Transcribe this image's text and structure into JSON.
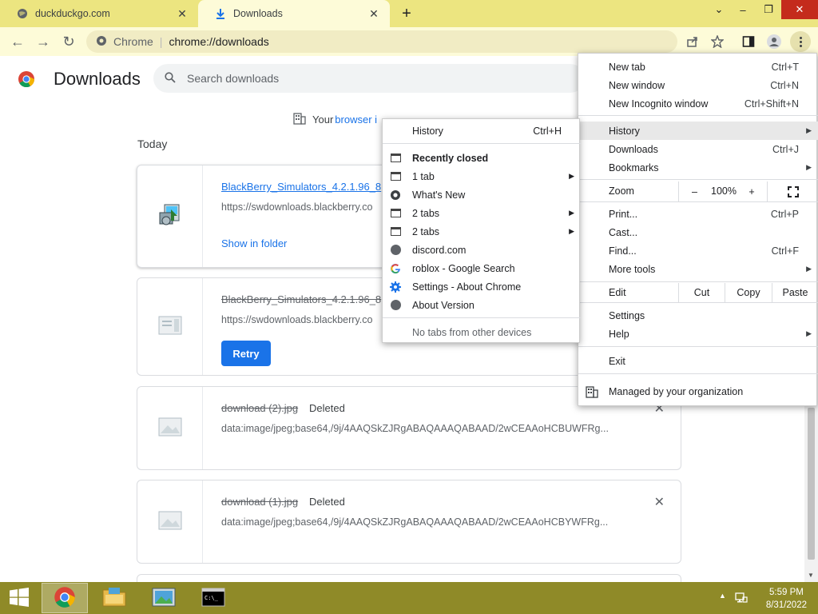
{
  "tabs": [
    {
      "title": "duckduckgo.com",
      "active": false
    },
    {
      "title": "Downloads",
      "active": true
    }
  ],
  "omnibox": {
    "scheme_label": "Chrome",
    "url": "chrome://downloads"
  },
  "downloads": {
    "title": "Downloads",
    "search_placeholder": "Search downloads",
    "managed_prefix": "Your",
    "managed_link": "browser i",
    "section_today": "Today",
    "items": [
      {
        "name": "BlackBerry_Simulators_4.2.1.96_8",
        "source": "https://swdownloads.blackberry.co",
        "action": "Show in folder",
        "state": "complete"
      },
      {
        "name": "BlackBerry_Simulators_4.2.1.96_8",
        "source": "https://swdownloads.blackberry.co",
        "action": "Retry",
        "state": "failed"
      },
      {
        "name": "download (2).jpg",
        "status": "Deleted",
        "source": "data:image/jpeg;base64,/9j/4AAQSkZJRgABAQAAAQABAAD/2wCEAAoHCBUWFRg...",
        "state": "deleted"
      },
      {
        "name": "download (1).jpg",
        "status": "Deleted",
        "source": "data:image/jpeg;base64,/9j/4AAQSkZJRgABAQAAAQABAAD/2wCEAAoHCBYWFRg...",
        "state": "deleted"
      }
    ]
  },
  "main_menu": {
    "new_tab": "New tab",
    "new_tab_sc": "Ctrl+T",
    "new_window": "New window",
    "new_window_sc": "Ctrl+N",
    "new_incognito": "New Incognito window",
    "new_incognito_sc": "Ctrl+Shift+N",
    "history": "History",
    "downloads": "Downloads",
    "downloads_sc": "Ctrl+J",
    "bookmarks": "Bookmarks",
    "zoom": "Zoom",
    "zoom_minus": "–",
    "zoom_value": "100%",
    "zoom_plus": "+",
    "print": "Print...",
    "print_sc": "Ctrl+P",
    "cast": "Cast...",
    "find": "Find...",
    "find_sc": "Ctrl+F",
    "more_tools": "More tools",
    "edit": "Edit",
    "cut": "Cut",
    "copy": "Copy",
    "paste": "Paste",
    "settings": "Settings",
    "help": "Help",
    "exit": "Exit",
    "managed": "Managed by your organization"
  },
  "history_menu": {
    "history": "History",
    "history_sc": "Ctrl+H",
    "recently_closed": "Recently closed",
    "items": [
      {
        "label": "1 tab",
        "icon": "tab-icon",
        "submenu": true
      },
      {
        "label": "What's New",
        "icon": "chrome-icon",
        "submenu": false
      },
      {
        "label": "2 tabs",
        "icon": "tab-icon",
        "submenu": true
      },
      {
        "label": "2 tabs",
        "icon": "tab-icon",
        "submenu": true
      },
      {
        "label": "discord.com",
        "icon": "globe-icon",
        "submenu": false
      },
      {
        "label": "roblox - Google Search",
        "icon": "google-icon",
        "submenu": false
      },
      {
        "label": "Settings - About Chrome",
        "icon": "settings-icon",
        "submenu": false
      },
      {
        "label": "About Version",
        "icon": "globe-icon",
        "submenu": false
      }
    ],
    "no_tabs": "No tabs from other devices"
  },
  "taskbar": {
    "time": "5:59 PM",
    "date": "8/31/2022"
  },
  "colors": {
    "tabstrip": "#ece580",
    "toolbar": "#fdfbd8",
    "taskbar": "#8f8a28",
    "accent": "#1a73e8"
  }
}
